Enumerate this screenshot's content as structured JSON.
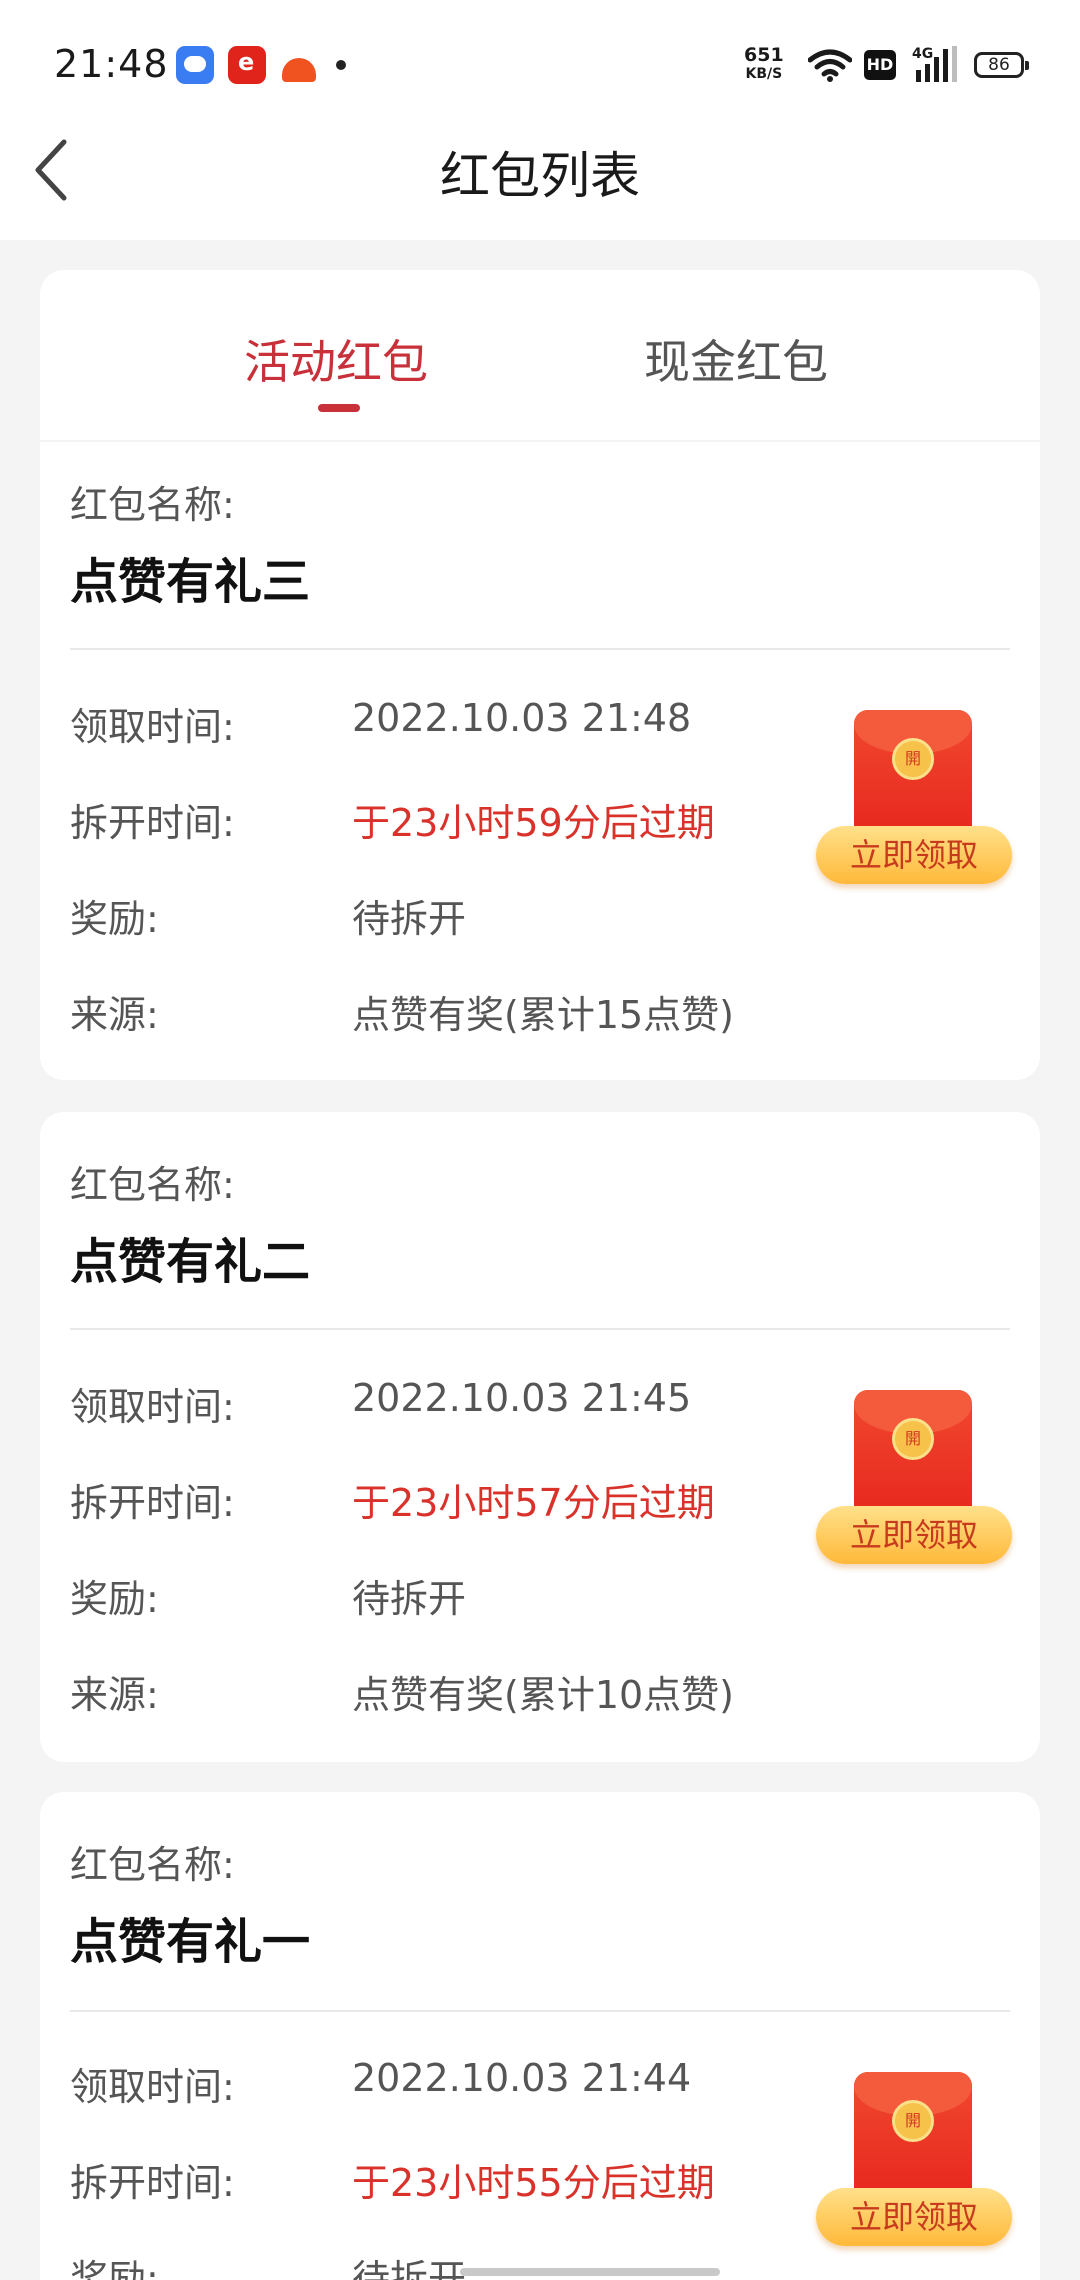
{
  "status_bar": {
    "time": "21:48",
    "net_speed_value": "651",
    "net_speed_unit": "KB/S",
    "hd": "HD",
    "network": "4G",
    "battery": "86"
  },
  "header": {
    "title": "红包列表"
  },
  "tabs": [
    {
      "label": "活动红包",
      "active": true
    },
    {
      "label": "现金红包",
      "active": false
    }
  ],
  "labels": {
    "name": "红包名称:",
    "receive_time": "领取时间:",
    "open_time": "拆开时间:",
    "reward": "奖励:",
    "source": "来源:",
    "claim_button": "立即领取",
    "seal": "開"
  },
  "packets": [
    {
      "name": "点赞有礼三",
      "receive_time": "2022.10.03 21:48",
      "open_time": "于23小时59分后过期",
      "reward": "待拆开",
      "source": "点赞有奖(累计15点赞)"
    },
    {
      "name": "点赞有礼二",
      "receive_time": "2022.10.03 21:45",
      "open_time": "于23小时57分后过期",
      "reward": "待拆开",
      "source": "点赞有奖(累计10点赞)"
    },
    {
      "name": "点赞有礼一",
      "receive_time": "2022.10.03 21:44",
      "open_time": "于23小时55分后过期",
      "reward": "待拆开",
      "source": ""
    }
  ],
  "colors": {
    "accent": "#c8303a",
    "expire_text": "#d9322b",
    "button_gradient_top": "#ffe08a",
    "button_gradient_bottom": "#ffb93a"
  }
}
